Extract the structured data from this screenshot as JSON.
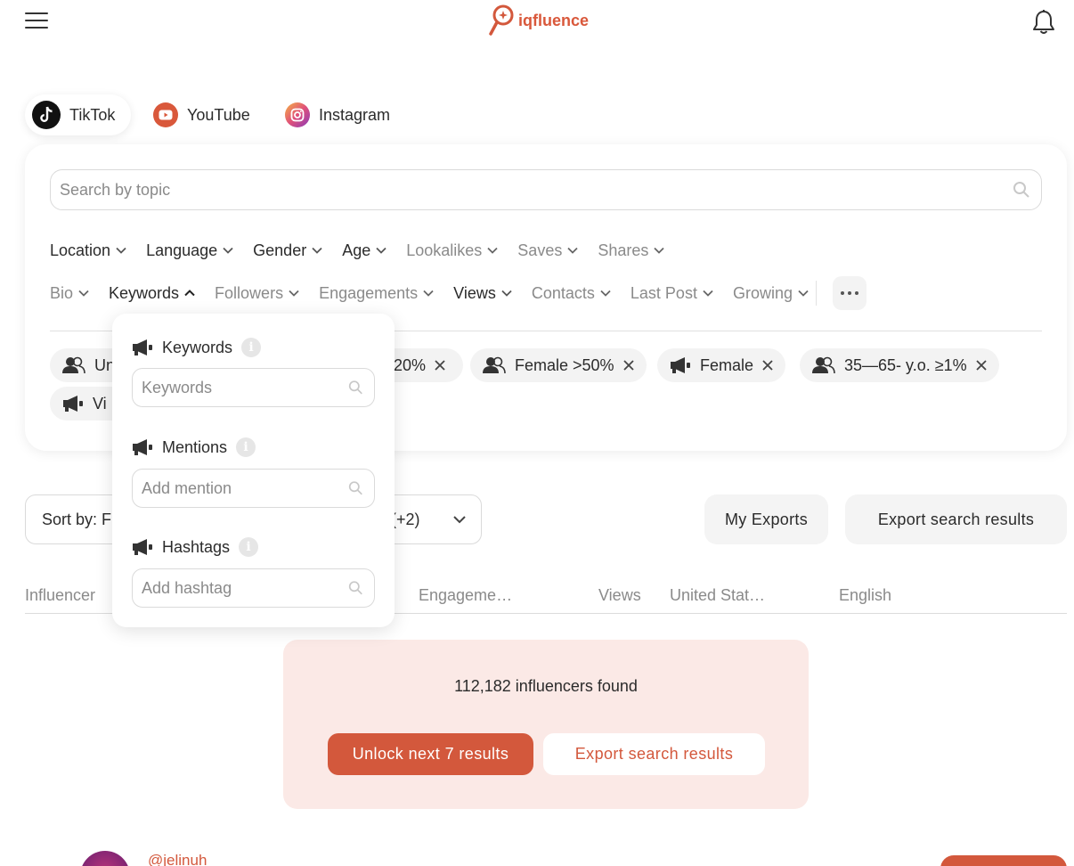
{
  "header": {
    "logo_text": "iqfluence",
    "brand_color": "#d3583c"
  },
  "platforms": [
    {
      "label": "TikTok",
      "icon": "tiktok-icon",
      "active": true
    },
    {
      "label": "YouTube",
      "icon": "youtube-icon",
      "active": false
    },
    {
      "label": "Instagram",
      "icon": "instagram-icon",
      "active": false
    }
  ],
  "search": {
    "placeholder": "Search by topic"
  },
  "filters": {
    "row1": [
      {
        "label": "Location",
        "muted": false
      },
      {
        "label": "Language",
        "muted": false
      },
      {
        "label": "Gender",
        "muted": false
      },
      {
        "label": "Age",
        "muted": false
      },
      {
        "label": "Lookalikes",
        "muted": true
      },
      {
        "label": "Saves",
        "muted": true
      },
      {
        "label": "Shares",
        "muted": true
      }
    ],
    "row2": [
      {
        "label": "Bio",
        "muted": true
      },
      {
        "label": "Keywords",
        "muted": false,
        "open": true
      },
      {
        "label": "Followers",
        "muted": true
      },
      {
        "label": "Engagements",
        "muted": true
      },
      {
        "label": "Views",
        "muted": false
      },
      {
        "label": "Contacts",
        "muted": true
      },
      {
        "label": "Last Post",
        "muted": true
      },
      {
        "label": "Growing",
        "muted": true
      }
    ]
  },
  "chips": [
    {
      "label": "Un",
      "icon": "audience-icon"
    },
    {
      "label": "20%",
      "icon": "audience-icon"
    },
    {
      "label": "Female >50%",
      "icon": "audience-icon"
    },
    {
      "label": "Female",
      "icon": "megaphone-icon"
    },
    {
      "label": "35—65- y.o. ≥1%",
      "icon": "audience-icon"
    },
    {
      "label": "Vi",
      "icon": "megaphone-icon"
    }
  ],
  "sort": {
    "label": "Sort by: F",
    "extra": "(+2)"
  },
  "buttons": {
    "my_exports": "My Exports",
    "export_search": "Export search results"
  },
  "table_headers": [
    "Influencer",
    "Engageme…",
    "Views",
    "United Stat…",
    "English"
  ],
  "results": {
    "count_text": "112,182 influencers found",
    "unlock_label": "Unlock next 7 results",
    "export_label": "Export search results"
  },
  "first_row": {
    "handle": "@jelinuh"
  },
  "dropdown": {
    "sections": [
      {
        "label": "Keywords",
        "placeholder": "Keywords"
      },
      {
        "label": "Mentions",
        "placeholder": "Add mention"
      },
      {
        "label": "Hashtags",
        "placeholder": "Add hashtag"
      }
    ]
  }
}
